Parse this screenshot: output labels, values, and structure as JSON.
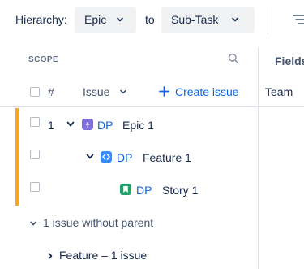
{
  "hierarchy": {
    "label": "Hierarchy:",
    "from_value": "Epic",
    "to_label": "to",
    "to_value": "Sub-Task"
  },
  "scope": {
    "title": "SCOPE",
    "fields_label": "Fields"
  },
  "table_header": {
    "number": "#",
    "issue": "Issue",
    "create_issue": "Create issue",
    "team": "Team"
  },
  "issues": [
    {
      "number": "1",
      "type": "epic",
      "key": "DP",
      "summary": "Epic 1",
      "expanded": true
    },
    {
      "number": "",
      "type": "feature",
      "key": "DP",
      "summary": "Feature 1",
      "expanded": true
    },
    {
      "number": "",
      "type": "story",
      "key": "DP",
      "summary": "Story 1",
      "expanded": false
    }
  ],
  "groups": {
    "without_parent": "1 issue without parent",
    "feature_group": "Feature – 1 issue"
  },
  "colors": {
    "accent_blue": "#0c66e4",
    "epic_purple": "#8270db",
    "feature_blue": "#388bff",
    "story_green": "#22a06b",
    "row_stripe": "#f5a623"
  }
}
